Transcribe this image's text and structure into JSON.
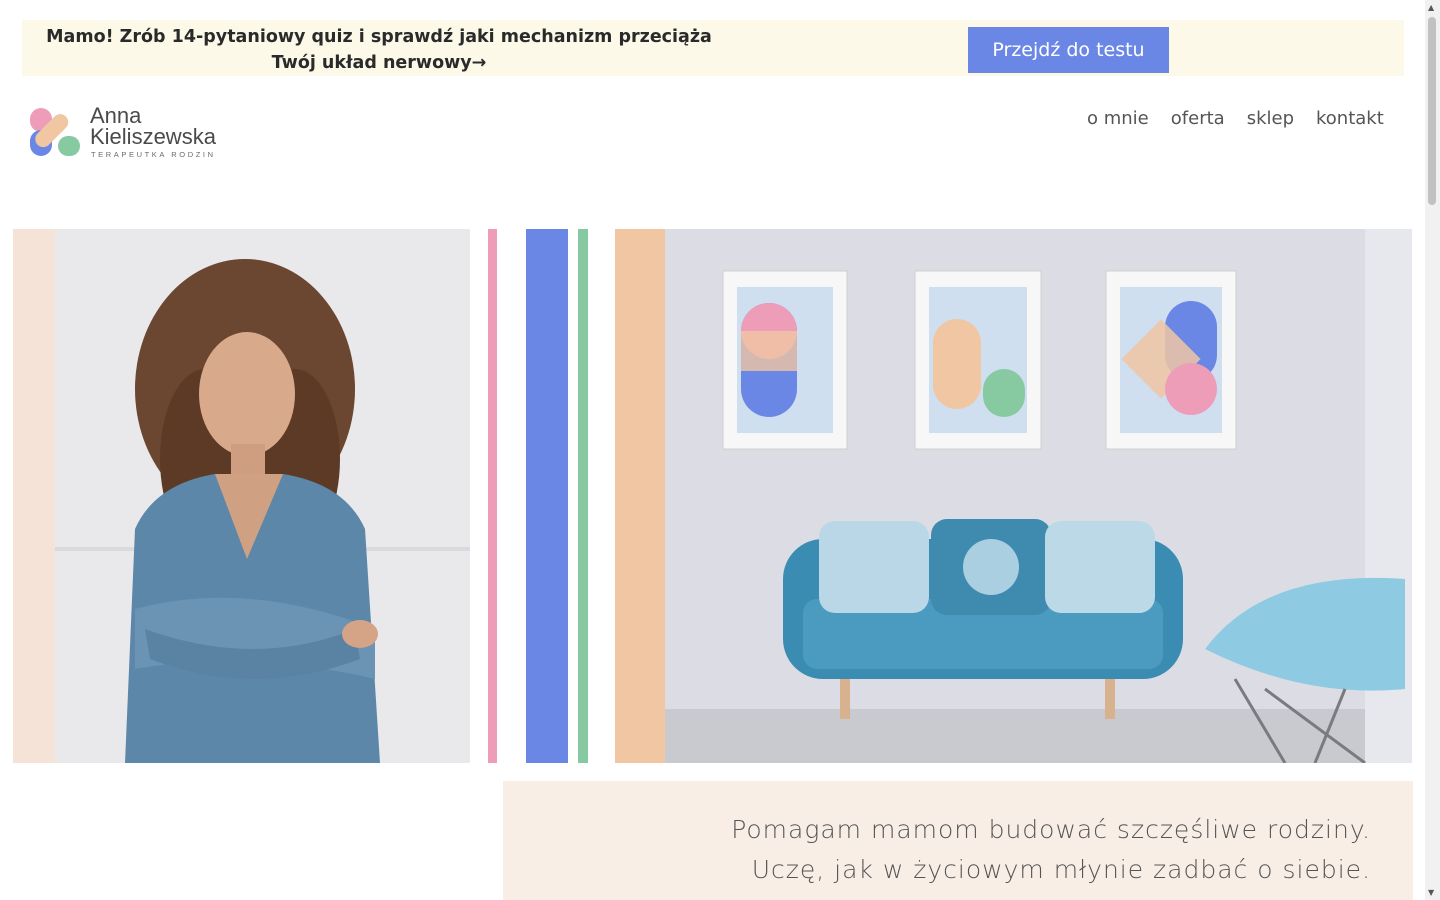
{
  "promo": {
    "text": "Mamo! Zrób 14-pytaniowy quiz i sprawdź jaki mechanizm przeciąża Twój układ nerwowy→",
    "button_label": "Przejdź do testu"
  },
  "logo": {
    "name_first": "Anna",
    "name_last": "Kieliszewska",
    "subtitle": "TERAPEUTKA RODZIN"
  },
  "nav": {
    "items": [
      {
        "label": "o mnie"
      },
      {
        "label": "oferta"
      },
      {
        "label": "sklep"
      },
      {
        "label": "kontakt"
      }
    ]
  },
  "hero": {
    "tagline_line1": "Pomagam mamom budować szczęśliwe rodziny.",
    "tagline_line2": "Uczę, jak w życiowym młynie zadbać o siebie."
  },
  "colors": {
    "accent_blue": "#6b87e6",
    "pink": "#ee9db8",
    "green": "#87caa1",
    "peach": "#f0c6a3",
    "banner_bg": "#fcf9e9",
    "tagline_bg": "#f9eee6"
  }
}
